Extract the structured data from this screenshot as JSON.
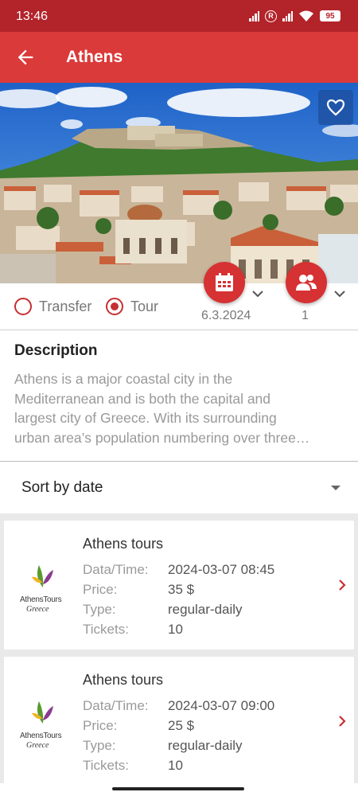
{
  "status": {
    "time": "13:46",
    "reg": "R",
    "battery": "95"
  },
  "header": {
    "title": "Athens"
  },
  "options": {
    "transfer_label": "Transfer",
    "tour_label": "Tour",
    "date_value": "6.3.2024",
    "people_value": "1"
  },
  "description": {
    "title": "Description",
    "lines": [
      "Athens is a major coastal city in the",
      "Mediterranean and is both the capital and",
      "largest city of Greece. With its surrounding",
      "urban area’s population numbering over three…"
    ]
  },
  "sort": {
    "label": "Sort by date"
  },
  "results": [
    {
      "title": "Athens tours",
      "logo_text": "AthensTours",
      "logo_sub": "Greece",
      "rows": [
        {
          "key": "Data/Time:",
          "value": "2024-03-07 08:45"
        },
        {
          "key": "Price:",
          "value": "35 $"
        },
        {
          "key": "Type:",
          "value": "regular-daily"
        },
        {
          "key": "Tickets:",
          "value": "10"
        }
      ]
    },
    {
      "title": "Athens tours",
      "logo_text": "AthensTours",
      "logo_sub": "Greece",
      "rows": [
        {
          "key": "Data/Time:",
          "value": "2024-03-07 09:00"
        },
        {
          "key": "Price:",
          "value": "25 $"
        },
        {
          "key": "Type:",
          "value": "regular-daily"
        },
        {
          "key": "Tickets:",
          "value": "10"
        }
      ]
    }
  ]
}
